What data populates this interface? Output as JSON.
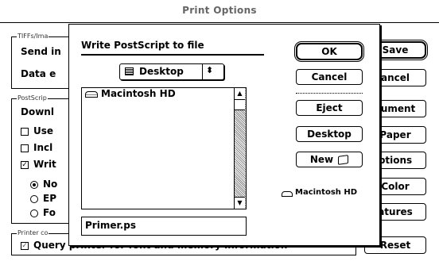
{
  "window": {
    "title": "Print Options"
  },
  "bg": {
    "tiffs_group_title": "TIFFs/Ima",
    "send_line": "Send in",
    "data_line": "Data e",
    "postscript_group_title": "PostScrip",
    "download_line": "Downl",
    "use_label": "Use",
    "incl_label": "Incl",
    "writ_label": "Writ",
    "radio_no_label": "No",
    "radio_ep_label": "EP",
    "radio_fo_label": "Fo",
    "printer_group_title": "Printer co",
    "query_label": "Query printer for font and memory information",
    "buttons": {
      "save": "Save",
      "cancel": "ancel",
      "document": "cument",
      "paper": "Paper",
      "options": "ptions",
      "color": "Color",
      "features": "atures",
      "reset": "Reset"
    }
  },
  "dialog": {
    "title": "Write PostScript to file",
    "location_popup": "Desktop",
    "files": [
      "Macintosh HD"
    ],
    "filename_value": "Primer.ps",
    "disk_label": "Macintosh HD",
    "buttons": {
      "ok": "OK",
      "cancel": "Cancel",
      "eject": "Eject",
      "desktop": "Desktop",
      "new": "New"
    }
  }
}
